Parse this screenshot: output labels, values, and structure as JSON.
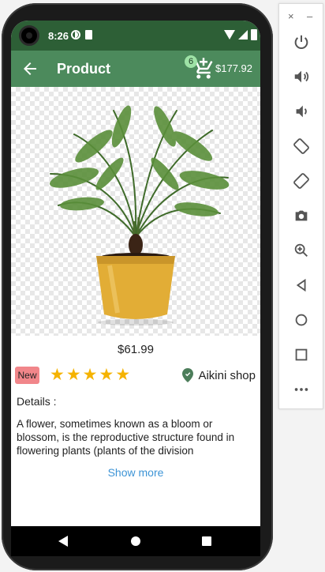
{
  "status_bar": {
    "time": "8:26"
  },
  "app_bar": {
    "title": "Product",
    "cart_count": "6",
    "cart_total": "$177.92"
  },
  "product": {
    "price": "$61.99",
    "badge": "New",
    "rating_stars": 5,
    "stars": [
      "★",
      "★",
      "★",
      "★",
      "★"
    ],
    "shop_name": "Aikini shop",
    "details_label": "Details :",
    "description": "A flower, sometimes known as a bloom or blossom, is the reproductive structure found in flowering plants (plants of the division",
    "show_more": "Show more"
  },
  "colors": {
    "status_bar": "#2d5f36",
    "app_bar": "#4c8a5c",
    "badge_bg": "#f1868a",
    "star": "#f5b301",
    "link": "#3d94d6",
    "pot": "#e2ad36"
  },
  "emulator_panel": {
    "window_buttons": {
      "close": "×",
      "minimize": "–"
    },
    "buttons": [
      "power-icon",
      "volume-up-icon",
      "volume-down-icon",
      "rotate-left-icon",
      "rotate-right-icon",
      "camera-icon",
      "zoom-icon",
      "back-icon",
      "home-icon",
      "overview-icon",
      "more-icon"
    ]
  }
}
